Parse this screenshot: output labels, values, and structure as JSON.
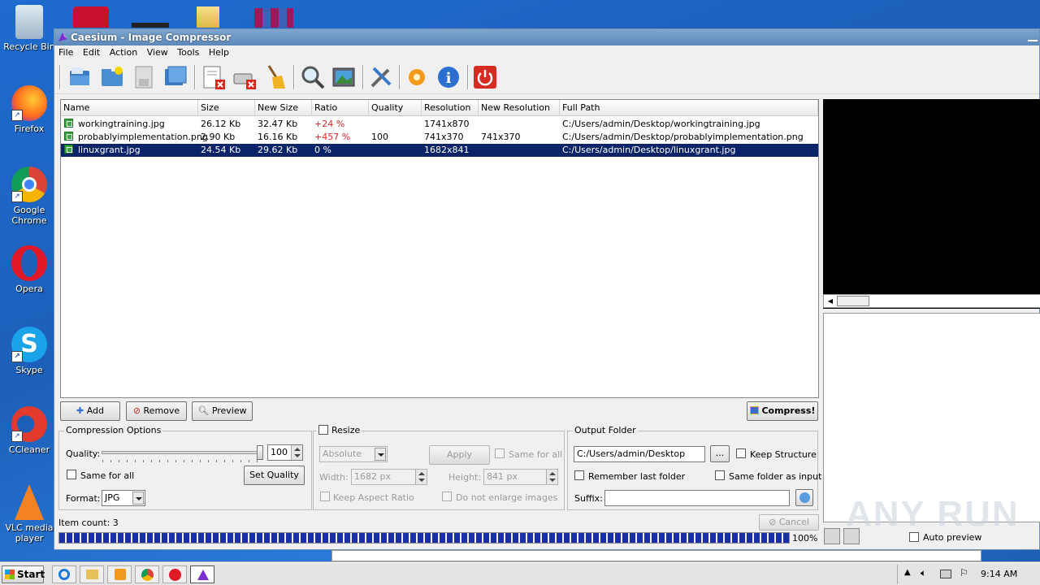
{
  "desktop": {
    "icons": [
      {
        "label": "Recycle Bin"
      },
      {
        "label": "Firefox"
      },
      {
        "label": "Google Chrome"
      },
      {
        "label": "Opera"
      },
      {
        "label": "Skype"
      },
      {
        "label": "CCleaner"
      },
      {
        "label": "VLC media player"
      }
    ]
  },
  "window": {
    "title": "Caesium - Image Compressor",
    "menu": [
      "File",
      "Edit",
      "Action",
      "View",
      "Tools",
      "Help"
    ],
    "toolbar_icons": [
      "open-folder-icon",
      "add-folder-icon",
      "save-icon",
      "copy-icon",
      "remove-file-icon",
      "clear-list-icon",
      "clean-icon",
      "preview-icon",
      "image-preview-icon",
      "settings-icon",
      "update-icon",
      "info-icon",
      "exit-icon"
    ]
  },
  "table": {
    "columns": [
      "Name",
      "Size",
      "New Size",
      "Ratio",
      "Quality",
      "Resolution",
      "New Resolution",
      "Full Path"
    ],
    "rows": [
      {
        "name": "workingtraining.jpg",
        "size": "26.12 Kb",
        "new_size": "32.47 Kb",
        "ratio": "+24 %",
        "quality": "",
        "resolution": "1741x870",
        "new_resolution": "",
        "path": "C:/Users/admin/Desktop/workingtraining.jpg"
      },
      {
        "name": "probablyimplementation.png",
        "size": "2.90 Kb",
        "new_size": "16.16 Kb",
        "ratio": "+457 %",
        "quality": "100",
        "resolution": "741x370",
        "new_resolution": "741x370",
        "path": "C:/Users/admin/Desktop/probablyimplementation.png"
      },
      {
        "name": "linuxgrant.jpg",
        "size": "24.54 Kb",
        "new_size": "29.62 Kb",
        "ratio": "0 %",
        "quality": "",
        "resolution": "1682x841",
        "new_resolution": "",
        "path": "C:/Users/admin/Desktop/linuxgrant.jpg"
      }
    ]
  },
  "actions": {
    "add": "Add",
    "remove": "Remove",
    "preview": "Preview",
    "compress": "Compress!"
  },
  "compression": {
    "title": "Compression Options",
    "quality_label": "Quality:",
    "quality_value": "100",
    "same_for_all": "Same for all",
    "set_quality": "Set Quality",
    "format_label": "Format:",
    "format_value": "JPG"
  },
  "resize": {
    "title": "Resize",
    "mode": "Absolute",
    "apply": "Apply",
    "same_for_all": "Same for all",
    "width_label": "Width:",
    "width_value": "1682 px",
    "height_label": "Height:",
    "height_value": "841 px",
    "keep_aspect": "Keep Aspect Ratio",
    "no_enlarge": "Do not enlarge images"
  },
  "output": {
    "title": "Output Folder",
    "path": "C:/Users/admin/Desktop",
    "browse": "...",
    "keep_structure": "Keep Structure",
    "remember_last": "Remember last folder",
    "same_as_input": "Same folder as input",
    "suffix_label": "Suffix:",
    "suffix_value": ""
  },
  "status": {
    "item_count": "Item count: 3",
    "cancel": "Cancel",
    "progress_text": "100%",
    "progress": 1.0
  },
  "preview_panel": {
    "auto_preview": "Auto preview"
  },
  "taskbar": {
    "start": "Start",
    "time": "9:14 AM"
  },
  "watermark": "ANY RUN"
}
